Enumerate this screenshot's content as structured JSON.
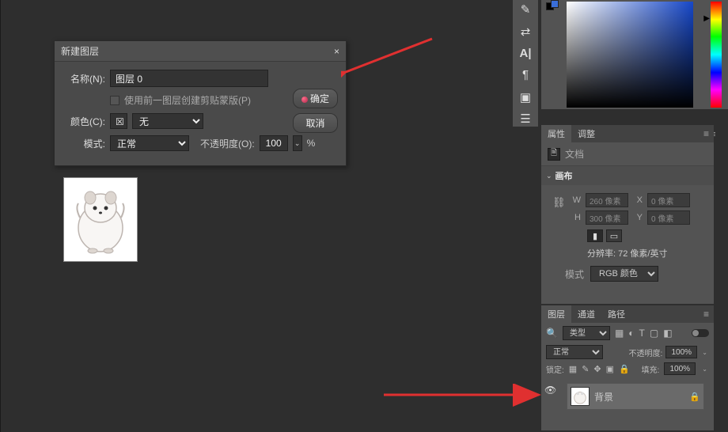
{
  "dialog": {
    "title": "新建图层",
    "name_label": "名称(N):",
    "name_value": "图层 0",
    "clip_label": "使用前一图层创建剪贴蒙版(P)",
    "color_label": "颜色(C):",
    "color_value": "无",
    "mode_label": "模式:",
    "mode_value": "正常",
    "opacity_label": "不透明度(O):",
    "opacity_value": "100",
    "percent": "%",
    "ok": "确定",
    "cancel": "取消"
  },
  "properties": {
    "tab_props": "属性",
    "tab_adjust": "调整",
    "doc_label": "文档",
    "section": "画布",
    "w_label": "W",
    "w_value": "260 像素",
    "h_label": "H",
    "h_value": "300 像素",
    "x_label": "X",
    "x_value": "0 像素",
    "y_label": "Y",
    "y_value": "0 像素",
    "res_label": "分辨率: 72 像素/英寸",
    "mode_label": "模式",
    "mode_value": "RGB 颜色"
  },
  "layers": {
    "tab_layers": "图层",
    "tab_channels": "通道",
    "tab_paths": "路径",
    "filter_kind": "类型",
    "blend_mode": "正常",
    "opacity_label": "不透明度:",
    "opacity_val": "100%",
    "lock_label": "锁定:",
    "fill_label": "填充:",
    "fill_val": "100%",
    "bg_layer": "背景"
  }
}
